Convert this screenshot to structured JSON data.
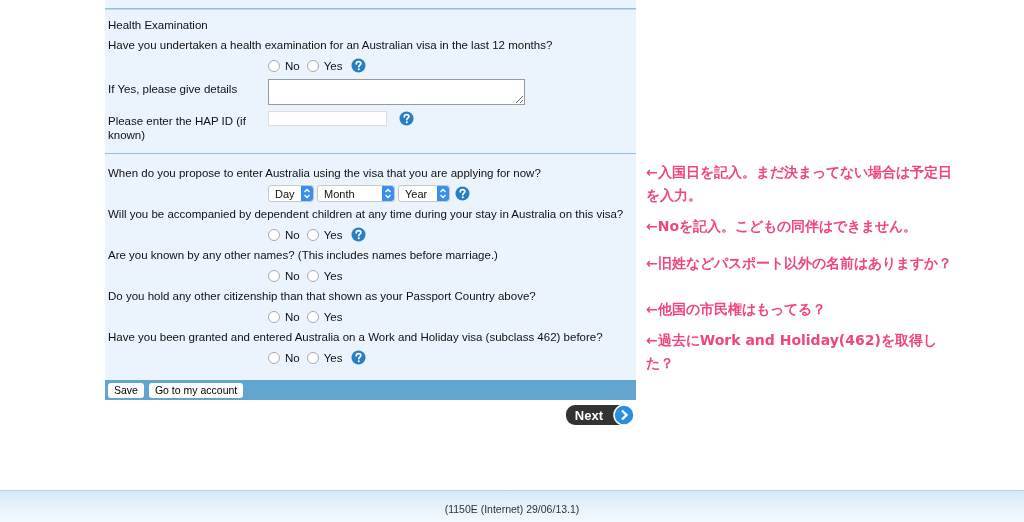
{
  "sections": [
    {
      "heading": "Health Examination",
      "items": [
        {
          "kind": "radio",
          "question": "Have you undertaken a health examination for an Australian visa in the last 12 months?",
          "options": [
            {
              "label": "No",
              "selected": false
            },
            {
              "label": "Yes",
              "selected": false
            }
          ],
          "help": true
        },
        {
          "kind": "textarea",
          "label": "If Yes, please give details"
        },
        {
          "kind": "text",
          "label": "Please enter the HAP ID (if known)",
          "help": true
        }
      ]
    },
    {
      "items": [
        {
          "kind": "date",
          "question": "When do you propose to enter Australia using the visa that you are applying for now?",
          "selects": [
            "Day",
            "Month",
            "Year"
          ],
          "help": true
        },
        {
          "kind": "radio",
          "question": "Will you be accompanied by dependent children at any time during your stay in Australia on this visa?",
          "options": [
            {
              "label": "No",
              "selected": false
            },
            {
              "label": "Yes",
              "selected": false
            }
          ],
          "help": true
        },
        {
          "kind": "radio",
          "question": "Are you known by any other names? (This includes names before marriage.)",
          "options": [
            {
              "label": "No",
              "selected": false
            },
            {
              "label": "Yes",
              "selected": false
            }
          ],
          "help": false
        },
        {
          "kind": "radio",
          "question": "Do you hold any other citizenship than that shown as your Passport Country above?",
          "options": [
            {
              "label": "No",
              "selected": false
            },
            {
              "label": "Yes",
              "selected": false
            }
          ],
          "help": false
        },
        {
          "kind": "radio",
          "question": "Have you been granted and entered Australia on a Work and Holiday visa (subclass 462) before?",
          "options": [
            {
              "label": "No",
              "selected": false
            },
            {
              "label": "Yes",
              "selected": false
            }
          ],
          "help": true
        }
      ]
    }
  ],
  "actions": [
    "Save",
    "Go to my account"
  ],
  "next": "Next",
  "notes": [
    {
      "lines": [
        "←入国日を記入。まだ決まってない場合は予定日",
        "を入力。"
      ]
    },
    {
      "lines": [
        "←Noを記入。こどもの同伴はできません。"
      ]
    },
    {
      "lines": [
        "←旧姓などパスポート以外の名前はありますか？"
      ]
    },
    {
      "lines": [
        "←他国の市民権はもってる？"
      ]
    },
    {
      "lines": [
        "←過去にWork and Holiday(462)を取得し",
        "た？"
      ]
    }
  ],
  "footer": "(1150E (Internet) 29/06/13.1)"
}
